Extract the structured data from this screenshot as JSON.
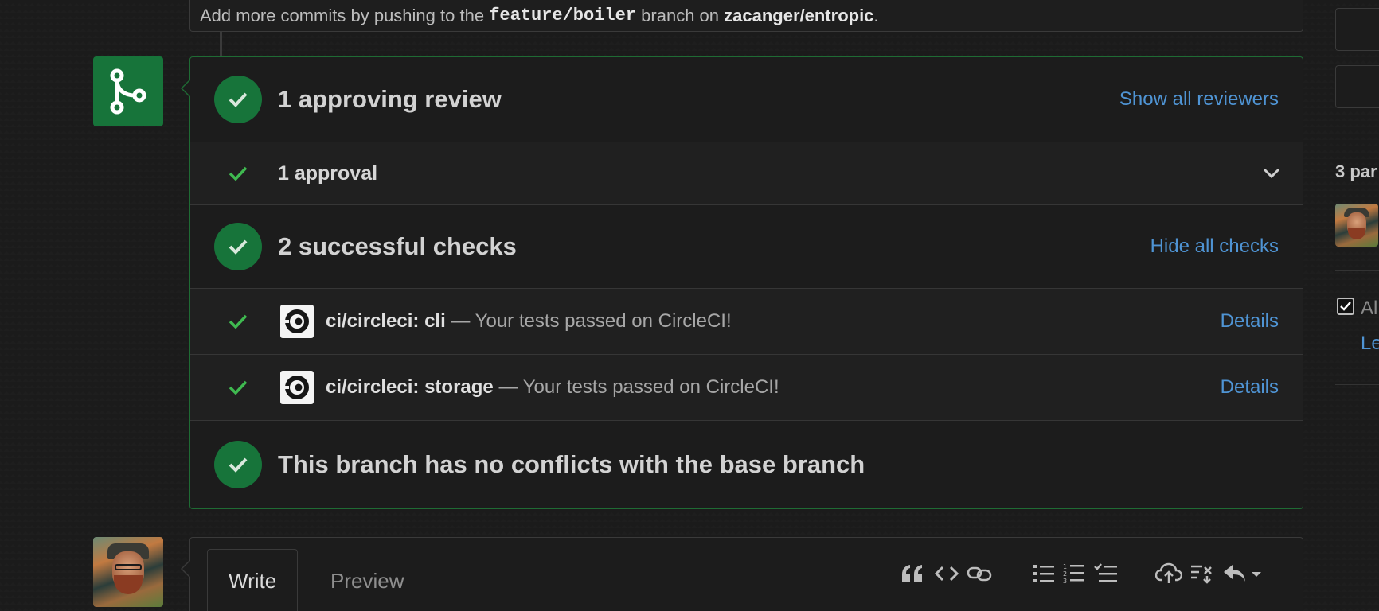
{
  "commit_hint": {
    "prefix": "Add more commits by pushing to the",
    "branch": "feature/boiler",
    "middle": "branch on",
    "repo": "zacanger/entropic",
    "suffix": "."
  },
  "merge_box": {
    "reviews": {
      "title": "1 approving review",
      "link": "Show all reviewers",
      "approval_label": "1 approval"
    },
    "checks": {
      "title": "2 successful checks",
      "link": "Hide all checks",
      "items": [
        {
          "name": "ci/circleci: cli",
          "separator": " — ",
          "description": "Your tests passed on CircleCI!",
          "details": "Details"
        },
        {
          "name": "ci/circleci: storage",
          "separator": " — ",
          "description": "Your tests passed on CircleCI!",
          "details": "Details"
        }
      ]
    },
    "conflicts": {
      "title": "This branch has no conflicts with the base branch"
    }
  },
  "composer": {
    "tabs": {
      "write": "Write",
      "preview": "Preview"
    },
    "toolbar_icons": [
      "quote-icon",
      "code-icon",
      "link-icon",
      "unordered-list-icon",
      "ordered-list-icon",
      "task-list-icon",
      "upload-icon",
      "cross-reference-icon",
      "reply-icon"
    ]
  },
  "sidebar": {
    "participants_label": "3 par",
    "allow_label": "Al",
    "learn_label": "Le"
  },
  "colors": {
    "success_green": "#17743a",
    "link_blue": "#4f94d4",
    "background": "#1b1b1b"
  }
}
